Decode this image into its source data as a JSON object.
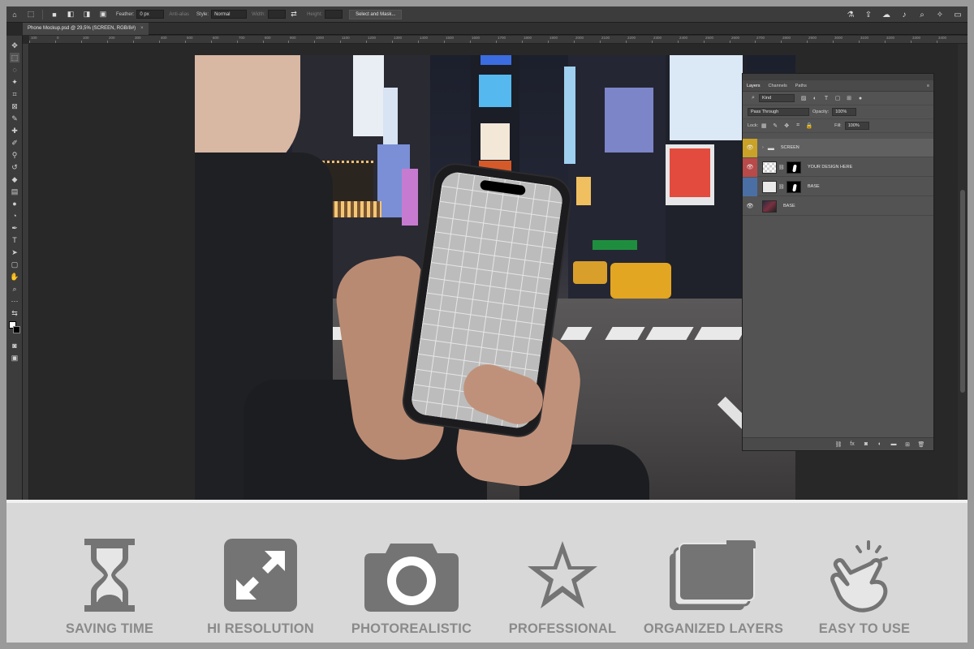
{
  "app": {
    "options_bar": {
      "feather_label": "Feather:",
      "feather_value": "0 px",
      "antialias_label": "Anti-alias",
      "style_label": "Style:",
      "style_value": "Normal",
      "width_label": "Width:",
      "height_label": "Height:",
      "select_mask_button": "Select and Mask..."
    },
    "document_tab": {
      "title": "Phone Mockup.psd @ 29,5% (SCREEN, RGB/8#)",
      "close": "×"
    },
    "ruler_ticks": [
      "100",
      "0",
      "100",
      "200",
      "300",
      "400",
      "500",
      "600",
      "700",
      "800",
      "900",
      "1000",
      "1100",
      "1200",
      "1300",
      "1400",
      "1500",
      "1600",
      "1700",
      "1800",
      "1900",
      "2000",
      "2100",
      "2200",
      "2300",
      "2400",
      "2500",
      "2600",
      "2700",
      "2800",
      "2900",
      "3000",
      "3100",
      "3200",
      "3300",
      "3400"
    ],
    "layers_panel": {
      "tabs": [
        "Layers",
        "Channels",
        "Paths"
      ],
      "filter_kind": "Kind",
      "blend_mode": "Pass Through",
      "opacity_label": "Opacity:",
      "opacity_value": "100%",
      "lock_label": "Lock:",
      "fill_label": "Fill:",
      "fill_value": "100%",
      "layers": [
        {
          "name": "SCREEN",
          "type": "group",
          "eye_color": "#c9a227"
        },
        {
          "name": "YOUR DESIGN HERE",
          "type": "smart-object",
          "eye_color": "#b84a4a"
        },
        {
          "name": "BASE",
          "type": "layer-with-mask",
          "eye_color": "#4a6fa5"
        },
        {
          "name": "BASE",
          "type": "image",
          "eye_color": "#535353"
        }
      ]
    }
  },
  "features": [
    {
      "label": "SAVING TIME",
      "icon": "hourglass-icon"
    },
    {
      "label": "HI RESOLUTION",
      "icon": "expand-icon"
    },
    {
      "label": "PHOTOREALISTIC",
      "icon": "camera-icon"
    },
    {
      "label": "PROFESSIONAL",
      "icon": "star-icon"
    },
    {
      "label": "ORGANIZED LAYERS",
      "icon": "layers-folder-icon"
    },
    {
      "label": "EASY TO USE",
      "icon": "tap-hand-icon"
    }
  ],
  "colors": {
    "feature_icon": "#747474",
    "feature_text": "#8a8a8a",
    "ps_background": "#282828"
  }
}
